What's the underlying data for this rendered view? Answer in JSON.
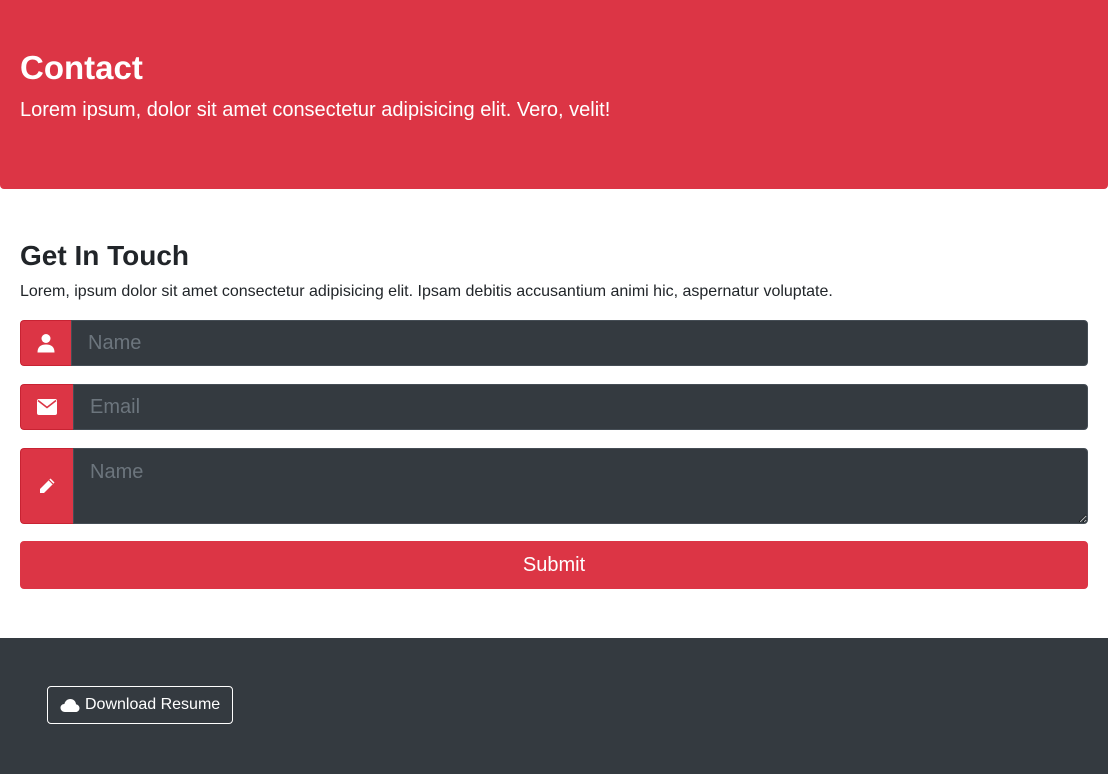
{
  "header": {
    "title": "Contact",
    "subtitle": "Lorem ipsum, dolor sit amet consectetur adipisicing elit. Vero, velit!"
  },
  "contact": {
    "heading": "Get In Touch",
    "description": "Lorem, ipsum dolor sit amet consectetur adipisicing elit. Ipsam debitis accusantium animi hic, aspernatur voluptate.",
    "name_field": {
      "placeholder": "Name",
      "value": "",
      "icon": "user-icon"
    },
    "email_field": {
      "placeholder": "Email",
      "value": "",
      "icon": "envelope-icon"
    },
    "message_field": {
      "placeholder": "Name",
      "value": "",
      "icon": "pencil-icon"
    },
    "submit_label": "Submit"
  },
  "footer": {
    "download_label": "Download Resume",
    "download_icon": "cloud-icon"
  },
  "colors": {
    "accent": "#dc3545",
    "dark": "#343a40",
    "text": "#212529"
  }
}
